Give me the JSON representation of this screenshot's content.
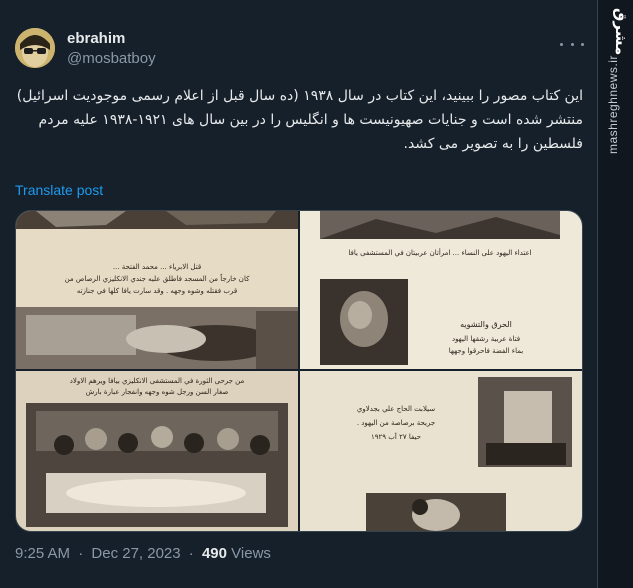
{
  "tweet": {
    "author_name": "ebrahim",
    "author_handle": "@mosbatboy",
    "text": "این کتاب مصور را ببینید، این کتاب در سال ۱۹۳۸ (ده سال قبل از اعلام رسمی موجودیت اسرائیل) منتشر شده است و جنایات صهیونیست ها و انگلیس را در بین سال های ۱۹۲۱-۱۹۳۸ علیه مردم فلسطین را به تصویر می کشد.",
    "translate_label": "Translate post",
    "time": "9:25 AM",
    "date": "Dec 27, 2023",
    "separator": "·",
    "views_count": "490",
    "views_label": "Views"
  },
  "media": {
    "photo1_caption": "قتل الابرياء ... محمد الفتحة ... كان خارجاً من المسجد فاطلق عليه جندي الانكليزي الرصاص من قرب فقتله وشوه وجهه . وقد سارت يافا كلها في جنازته",
    "photo2_caption_top": "اعتداء اليهود على النساء ... امرأتان عربيتان في المستشفى يافا",
    "photo2_caption_mid": "الحرق والتشويه",
    "photo2_caption_mid2": "فتاة عربية رشقها اليهود بماء الفضة فاحرقوا وجهها",
    "photo3_caption": "من جرحى الثورة في المستشفى الانكليزي بيافا ويرهم الاولاد صغار السن ورجل شوه وجهه وانفجار عبارة بارش",
    "photo4_caption": "سيلابت الحاج علي بجدلاوي جريحة برصاصة من اليهود . حيفا ٢٧ آب ١٩٢٩"
  },
  "watermark": {
    "logo": "مشرق",
    "url": "mashreghnews.ir"
  },
  "colors": {
    "background": "#15202b",
    "text": "#e7e9ea",
    "secondary": "#8b98a5",
    "link": "#1d9bf0",
    "border": "#38444d"
  },
  "icons": [
    "more-icon",
    "avatar-image"
  ]
}
